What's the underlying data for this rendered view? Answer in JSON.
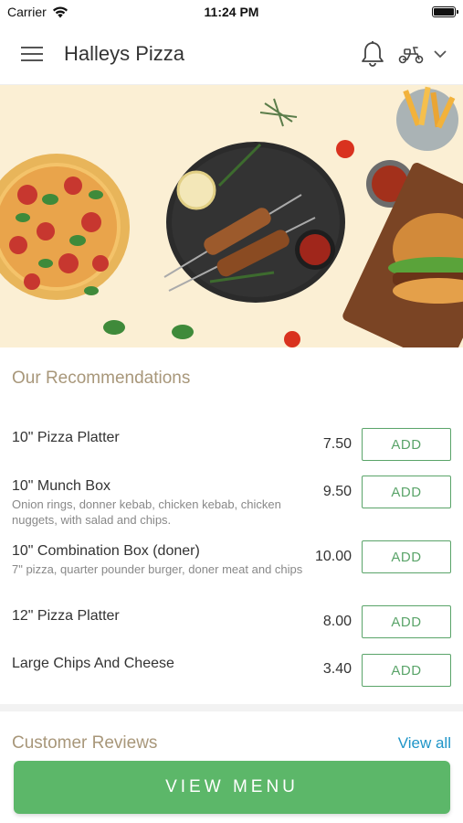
{
  "status_bar": {
    "carrier": "Carrier",
    "time": "11:24 PM"
  },
  "header": {
    "title": "Halleys Pizza",
    "icons": [
      "menu-icon",
      "bell-icon",
      "scooter-icon",
      "chevron-down-icon"
    ]
  },
  "hero": {
    "image": "food-banner: pizza, kebab skewers, fries, burger"
  },
  "recommendations": {
    "title": "Our Recommendations",
    "items": [
      {
        "name": "10\" Pizza Platter",
        "description": "",
        "price": "7.50",
        "action": "ADD"
      },
      {
        "name": "10\" Munch Box",
        "description": "Onion rings, donner kebab, chicken kebab, chicken nuggets, with salad and chips.",
        "price": "9.50",
        "action": "ADD"
      },
      {
        "name": "10\" Combination Box (doner)",
        "description": "7\" pizza, quarter pounder burger, doner meat and chips",
        "price": "10.00",
        "action": "ADD"
      },
      {
        "name": "12\" Pizza Platter",
        "description": "",
        "price": "8.00",
        "action": "ADD"
      },
      {
        "name": "Large Chips And Cheese",
        "description": "",
        "price": "3.40",
        "action": "ADD"
      }
    ]
  },
  "reviews": {
    "title": "Customer Reviews",
    "view_all": "View all"
  },
  "footer": {
    "view_menu": "VIEW MENU"
  },
  "colors": {
    "accent_green": "#5cb769",
    "link_blue": "#1f95c8",
    "section_title": "#a8977a",
    "hero_bg": "#fbefd4"
  }
}
